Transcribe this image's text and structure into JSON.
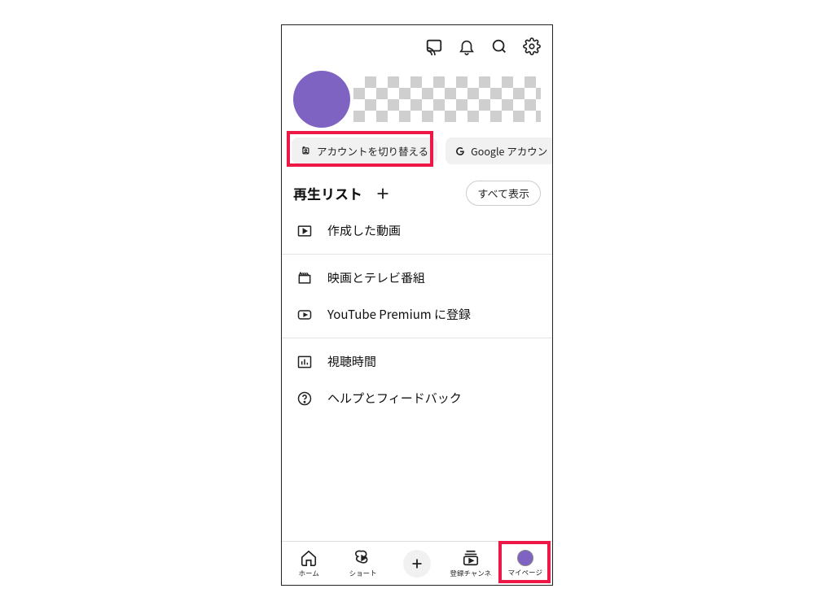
{
  "header": {
    "cast_icon": "cast-icon",
    "bell_icon": "bell-icon",
    "search_icon": "search-icon",
    "settings_icon": "settings-icon"
  },
  "profile": {
    "avatar_color": "#7f63c2"
  },
  "chips": {
    "switch_account": "アカウントを切り替える",
    "google_account": "Google アカウン"
  },
  "playlist": {
    "title": "再生リスト",
    "show_all": "すべて表示"
  },
  "rows": {
    "created": "作成した動画",
    "movies": "映画とテレビ番組",
    "premium": "YouTube Premium に登録",
    "watchtime": "視聴時間",
    "help": "ヘルプとフィードバック"
  },
  "nav": {
    "home": "ホーム",
    "shorts": "ショート",
    "subs": "登録チャンネ..",
    "mypage": "マイページ"
  }
}
